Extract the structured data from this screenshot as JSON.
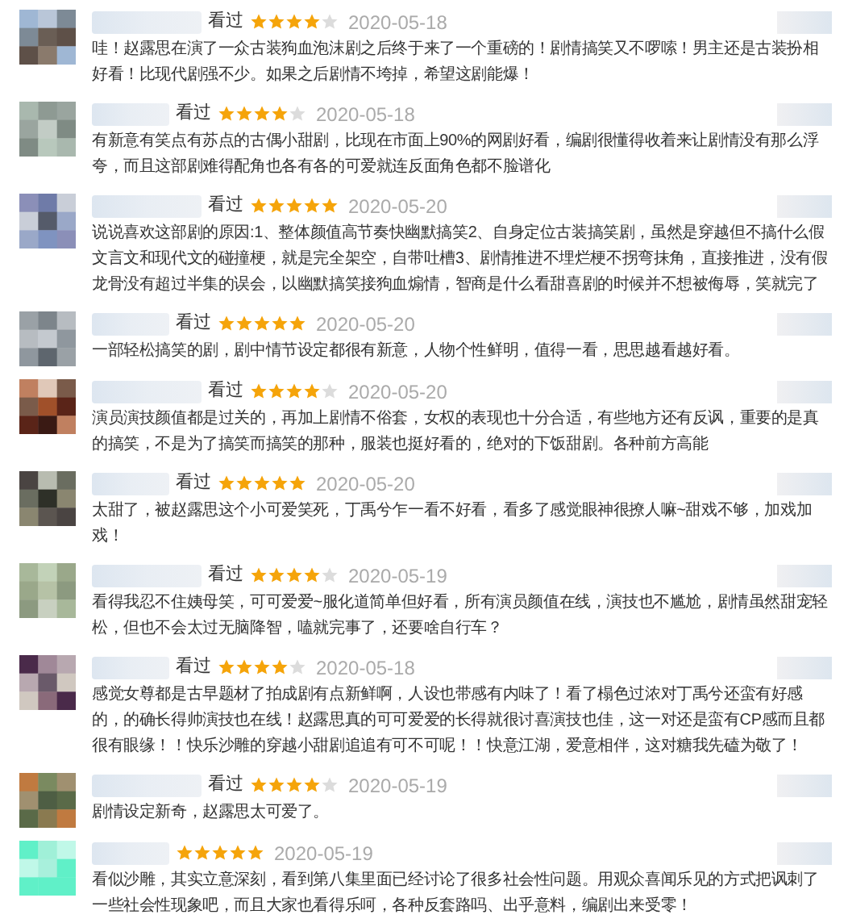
{
  "reviews": [
    {
      "status": "看过",
      "stars": 4,
      "date": "2020-05-18",
      "text": "哇！赵露思在演了一众古装狗血泡沫剧之后终于来了一个重磅的！剧情搞笑又不啰嗦！男主还是古装扮相好看！比现代剧强不少。如果之后剧情不垮掉，希望这剧能爆！"
    },
    {
      "status": "看过",
      "stars": 4,
      "date": "2020-05-18",
      "text": "有新意有笑点有苏点的古偶小甜剧，比现在市面上90%的网剧好看，编剧很懂得收着来让剧情没有那么浮夸，而且这部剧难得配角也各有各的可爱就连反面角色都不脸谱化"
    },
    {
      "status": "看过",
      "stars": 5,
      "date": "2020-05-20",
      "text": "说说喜欢这部剧的原因:1、整体颜值高节奏快幽默搞笑2、自身定位古装搞笑剧，虽然是穿越但不搞什么假文言文和现代文的碰撞梗，就是完全架空，自带吐槽3、剧情推进不埋烂梗不拐弯抹角，直接推进，没有假龙骨没有超过半集的误会，以幽默搞笑接狗血煽情，智商是什么看甜喜剧的时候并不想被侮辱，笑就完了"
    },
    {
      "status": "看过",
      "stars": 5,
      "date": "2020-05-20",
      "text": "一部轻松搞笑的剧，剧中情节设定都很有新意，人物个性鲜明，值得一看，思思越看越好看。"
    },
    {
      "status": "看过",
      "stars": 4,
      "date": "2020-05-20",
      "text": "演员演技颜值都是过关的，再加上剧情不俗套，女权的表现也十分合适，有些地方还有反讽，重要的是真的搞笑，不是为了搞笑而搞笑的那种，服装也挺好看的，绝对的下饭甜剧。各种前方高能"
    },
    {
      "status": "看过",
      "stars": 5,
      "date": "2020-05-20",
      "text": "太甜了，被赵露思这个小可爱笑死，丁禹兮乍一看不好看，看多了感觉眼神很撩人嘛~甜戏不够，加戏加戏！"
    },
    {
      "status": "看过",
      "stars": 4,
      "date": "2020-05-19",
      "text": "看得我忍不住姨母笑，可可爱爱~服化道简单但好看，所有演员颜值在线，演技也不尴尬，剧情虽然甜宠轻松，但也不会太过无脑降智，嗑就完事了，还要啥自行车？"
    },
    {
      "status": "看过",
      "stars": 4,
      "date": "2020-05-18",
      "text": "感觉女尊都是古早题材了拍成剧有点新鲜啊，人设也带感有内味了！看了榻色过浓对丁禹兮还蛮有好感的，的确长得帅演技也在线！赵露思真的可可爱爱的长得就很讨喜演技也佳，这一对还是蛮有CP感而且都很有眼缘！！快乐沙雕的穿越小甜剧追追有可不可呢！！快意江湖，爱意相伴，这对糖我先磕为敬了！"
    },
    {
      "status": "看过",
      "stars": 4,
      "date": "2020-05-19",
      "text": "剧情设定新奇，赵露思太可爱了。"
    },
    {
      "stars": 5,
      "date": "2020-05-19",
      "text": "看似沙雕，其实立意深刻，看到第八集里面已经讨论了很多社会性问题。用观众喜闻乐见的方式把讽刺了一些社会性现象吧，而且大家也看得乐呵，各种反套路吗、出乎意料，编剧出来受零！"
    }
  ]
}
